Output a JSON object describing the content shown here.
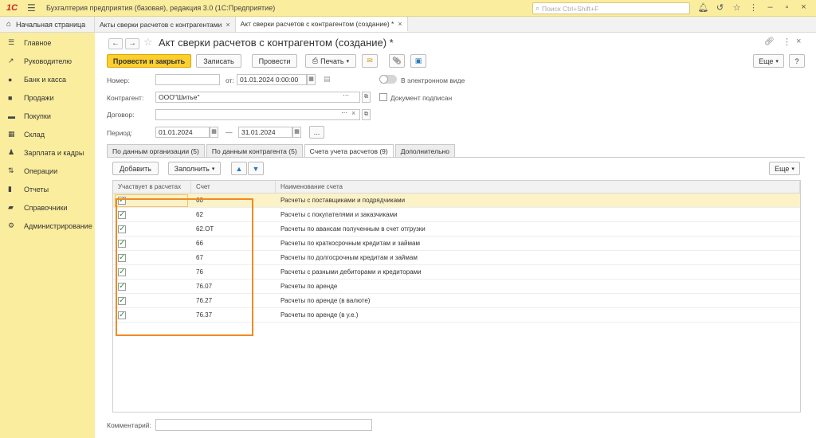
{
  "titlebar": {
    "logo": "1С",
    "title": "Бухгалтерия предприятия (базовая), редакция 3.0  (1С:Предприятие)",
    "search_placeholder": "Поиск Ctrl+Shift+F"
  },
  "tabs": {
    "home": "Начальная страница",
    "items": [
      {
        "label": "Акты сверки расчетов с контрагентами"
      },
      {
        "label": "Акт сверки расчетов с контрагентом (создание) *"
      }
    ]
  },
  "sidebar": {
    "items": [
      {
        "label": "Главное",
        "icon": "menu-icon"
      },
      {
        "label": "Руководителю",
        "icon": "chart-line-icon"
      },
      {
        "label": "Банк и касса",
        "icon": "coin-icon"
      },
      {
        "label": "Продажи",
        "icon": "bag-icon"
      },
      {
        "label": "Покупки",
        "icon": "cart-icon"
      },
      {
        "label": "Склад",
        "icon": "warehouse-icon"
      },
      {
        "label": "Зарплата и кадры",
        "icon": "person-icon"
      },
      {
        "label": "Операции",
        "icon": "operations-icon"
      },
      {
        "label": "Отчеты",
        "icon": "bar-chart-icon"
      },
      {
        "label": "Справочники",
        "icon": "book-icon"
      },
      {
        "label": "Администрирование",
        "icon": "gear-icon"
      }
    ]
  },
  "form": {
    "title": "Акт сверки расчетов с контрагентом (создание) *",
    "toolbar": {
      "post_close": "Провести и закрыть",
      "save": "Записать",
      "post": "Провести",
      "print": "Печать",
      "more": "Еще",
      "help": "?"
    },
    "number_label": "Номер:",
    "number_value": "",
    "from_label": "от:",
    "date_value": "01.01.2024  0:00:00",
    "electronic_label": "В электронном виде",
    "counterparty_label": "Контрагент:",
    "counterparty_value": "ООО\"Шитье\"",
    "signed_label": "Документ подписан",
    "contract_label": "Договор:",
    "contract_value": "",
    "period_label": "Период:",
    "period_from": "01.01.2024",
    "period_dash": "—",
    "period_to": "31.01.2024",
    "period_button": "...",
    "comment_label": "Комментарий:",
    "comment_value": ""
  },
  "inner_tabs": [
    {
      "label": "По данным организации (5)"
    },
    {
      "label": "По данным контрагента (5)"
    },
    {
      "label": "Счета учета расчетов (9)"
    },
    {
      "label": "Дополнительно"
    }
  ],
  "grid_toolbar": {
    "add": "Добавить",
    "fill": "Заполнить",
    "more": "Еще"
  },
  "grid": {
    "columns": [
      "Участвует в расчетах",
      "Счет",
      "Наименование счета"
    ],
    "rows": [
      {
        "checked": true,
        "account": "60",
        "name": "Расчеты с поставщиками и подрядчиками"
      },
      {
        "checked": true,
        "account": "62",
        "name": "Расчеты с покупателями и заказчиками"
      },
      {
        "checked": true,
        "account": "62.ОТ",
        "name": "Расчеты по авансам полученным в счет отгрузки"
      },
      {
        "checked": true,
        "account": "66",
        "name": "Расчеты по краткосрочным кредитам и займам"
      },
      {
        "checked": true,
        "account": "67",
        "name": "Расчеты по долгосрочным кредитам и займам"
      },
      {
        "checked": true,
        "account": "76",
        "name": "Расчеты с разными дебиторами и кредиторами"
      },
      {
        "checked": true,
        "account": "76.07",
        "name": "Расчеты по аренде"
      },
      {
        "checked": true,
        "account": "76.27",
        "name": "Расчеты по аренде (в валюте)"
      },
      {
        "checked": true,
        "account": "76.37",
        "name": "Расчеты по аренде (в у.е.)"
      }
    ]
  },
  "colors": {
    "accent_yellow": "#fbed9e",
    "primary_button": "#fccf2e",
    "highlight_frame": "#f08a24",
    "checkmark": "#2a9a3a"
  }
}
